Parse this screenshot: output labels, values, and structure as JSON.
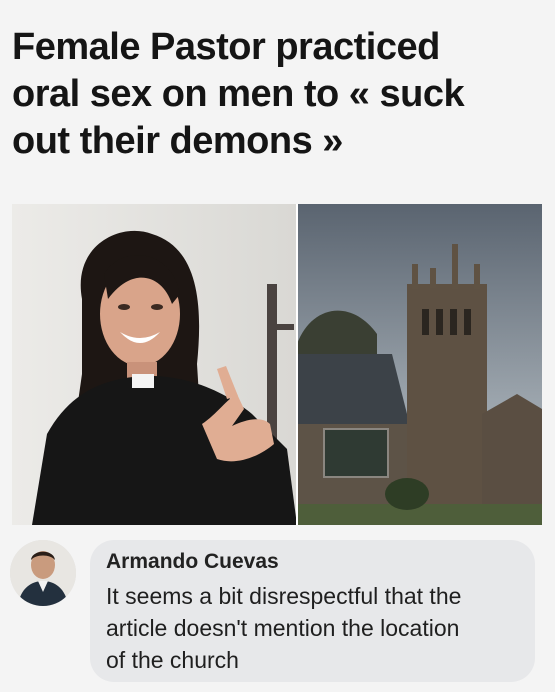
{
  "article": {
    "headline_lines": [
      "Female Pastor practiced",
      "oral sex on men to « suck",
      "out their demons »"
    ]
  },
  "comment": {
    "author": "Armando Cuevas",
    "text_lines": [
      "It seems a bit disrespectful that the",
      "article doesn't mention the location",
      "of the church"
    ]
  }
}
